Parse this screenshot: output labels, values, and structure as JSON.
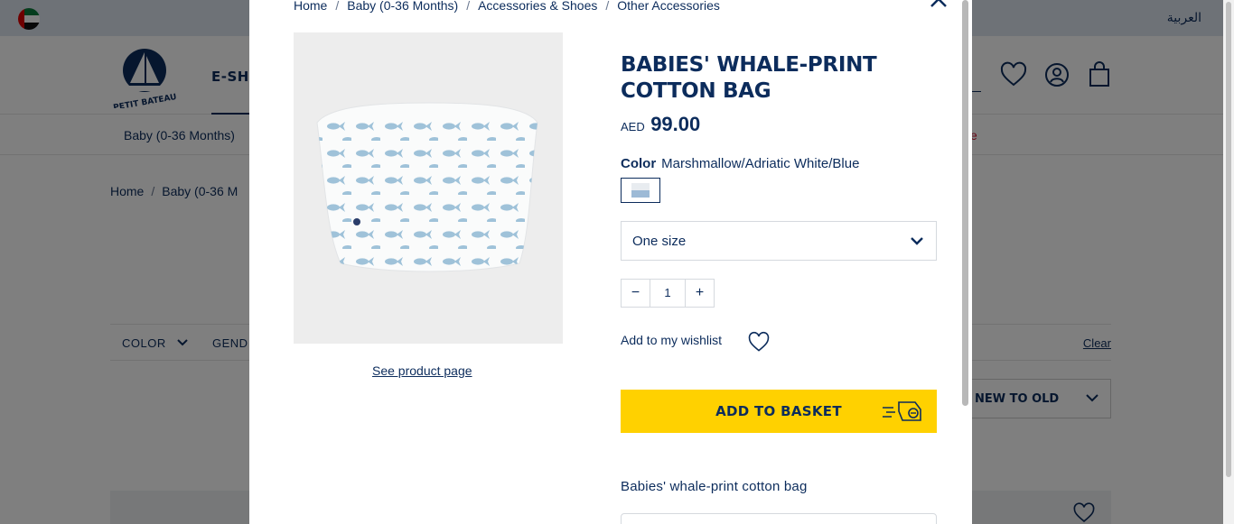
{
  "background": {
    "lang_label": "العربية",
    "nav_label": "E-SHO",
    "subnav_item": "Baby (0-36 Months)",
    "subnav_sale": "e",
    "breadcrumb_home": "Home",
    "breadcrumb_next": "Baby (0-36 M",
    "filter_color": "COLOR",
    "filter_gender": "GEND",
    "filter_clear": "Clear",
    "sort_label": "NEW TO OLD"
  },
  "modal": {
    "breadcrumb": [
      "Home",
      "Baby (0-36 Months)",
      "Accessories & Shoes",
      "Other Accessories"
    ],
    "see_product_page": "See product page",
    "title": "BABIES' WHALE-PRINT COTTON BAG",
    "price": {
      "currency": "AED",
      "amount": "99.00"
    },
    "color_label": "Color",
    "color_value": "Marshmallow/Adriatic White/Blue",
    "size_value": "One size",
    "quantity": "1",
    "qty_minus": "−",
    "qty_plus": "+",
    "wishlist_label": "Add to my wishlist",
    "add_to_basket": "ADD TO BASKET",
    "description": "Babies' whale-print cotton bag"
  },
  "colors": {
    "navy": "#0c2c5c",
    "yellow": "#ffd100",
    "sale_red": "#c8102e"
  },
  "icons": [
    "flag-uae-icon",
    "logo-boat-icon",
    "heart-icon",
    "user-icon",
    "bag-icon",
    "chevron-down-icon",
    "close-icon",
    "basket-hand-icon"
  ]
}
